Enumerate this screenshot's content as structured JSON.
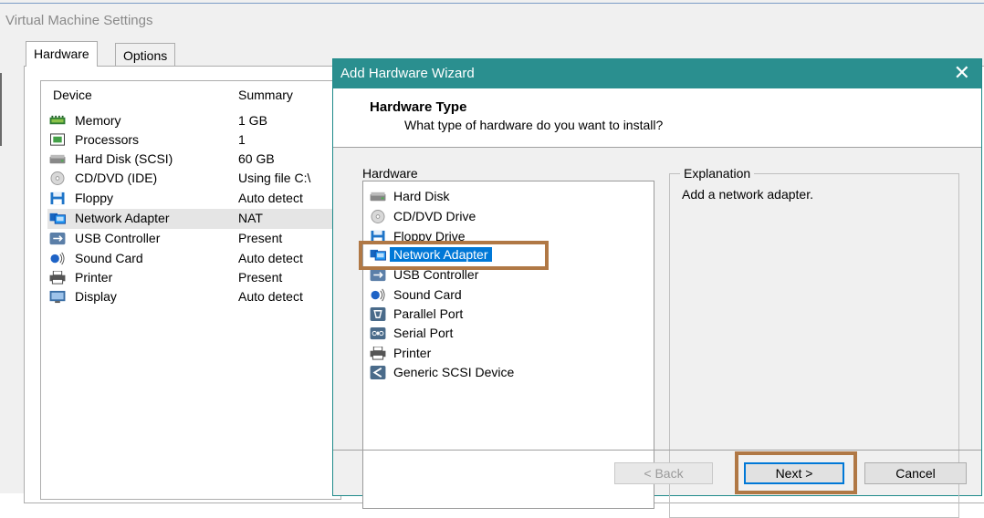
{
  "vm_settings": {
    "title": "Virtual Machine Settings",
    "tabs": [
      {
        "label": "Hardware",
        "active": true
      },
      {
        "label": "Options",
        "active": false
      }
    ],
    "columns": {
      "device": "Device",
      "summary": "Summary"
    },
    "devices": [
      {
        "name": "Memory",
        "summary": "1 GB",
        "icon": "memory-icon"
      },
      {
        "name": "Processors",
        "summary": "1",
        "icon": "processor-icon"
      },
      {
        "name": "Hard Disk (SCSI)",
        "summary": "60 GB",
        "icon": "hard-disk-icon"
      },
      {
        "name": "CD/DVD (IDE)",
        "summary": "Using file C:\\",
        "icon": "cd-dvd-icon"
      },
      {
        "name": "Floppy",
        "summary": "Auto detect",
        "icon": "floppy-icon"
      },
      {
        "name": "Network Adapter",
        "summary": "NAT",
        "icon": "network-adapter-icon",
        "selected": true
      },
      {
        "name": "USB Controller",
        "summary": "Present",
        "icon": "usb-icon"
      },
      {
        "name": "Sound Card",
        "summary": "Auto detect",
        "icon": "sound-card-icon"
      },
      {
        "name": "Printer",
        "summary": "Present",
        "icon": "printer-icon"
      },
      {
        "name": "Display",
        "summary": "Auto detect",
        "icon": "display-icon"
      }
    ]
  },
  "wizard": {
    "title": "Add Hardware Wizard",
    "close_glyph": "✕",
    "heading": "Hardware Type",
    "subheading": "What type of hardware do you want to install?",
    "hardware_label": "Hardware",
    "hardware_items": [
      {
        "name": "Hard Disk",
        "icon": "hard-disk-icon"
      },
      {
        "name": "CD/DVD Drive",
        "icon": "cd-dvd-icon"
      },
      {
        "name": "Floppy Drive",
        "icon": "floppy-icon"
      },
      {
        "name": "Network Adapter",
        "icon": "network-adapter-icon",
        "selected": true
      },
      {
        "name": "USB Controller",
        "icon": "usb-icon"
      },
      {
        "name": "Sound Card",
        "icon": "sound-card-icon"
      },
      {
        "name": "Parallel Port",
        "icon": "parallel-port-icon"
      },
      {
        "name": "Serial Port",
        "icon": "serial-port-icon"
      },
      {
        "name": "Printer",
        "icon": "printer-icon"
      },
      {
        "name": "Generic SCSI Device",
        "icon": "scsi-icon"
      }
    ],
    "explanation_label": "Explanation",
    "explanation_text": "Add a network adapter.",
    "buttons": {
      "back": "< Back",
      "next": "Next >",
      "cancel": "Cancel"
    }
  },
  "colors": {
    "titlebar": "#2a8f8f",
    "selection": "#0078d7",
    "highlight_box": "#b07845"
  }
}
